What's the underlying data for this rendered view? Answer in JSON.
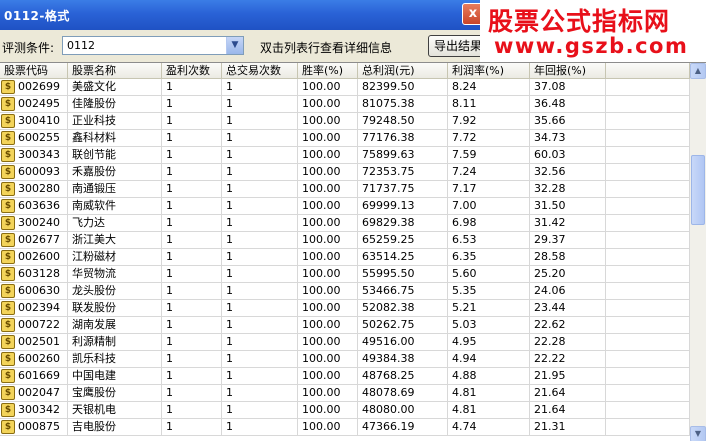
{
  "window": {
    "title": "0112-格式",
    "close_glyph": "x"
  },
  "watermark": {
    "line1": "股票公式指标网",
    "line2": "www.gszb.com"
  },
  "toolbar": {
    "condition_label": "评测条件:",
    "condition_value": "0112",
    "hint": "双击列表行查看详细信息",
    "export_label": "导出结果"
  },
  "columns": [
    "股票代码",
    "股票名称",
    "盈利次数",
    "总交易次数",
    "胜率(%)",
    "总利润(元)",
    "利润率(%)",
    "年回报(%)",
    ""
  ],
  "rows": [
    [
      "002699",
      "美盛文化",
      "1",
      "1",
      "100.00",
      "82399.50",
      "8.24",
      "37.08"
    ],
    [
      "002495",
      "佳隆股份",
      "1",
      "1",
      "100.00",
      "81075.38",
      "8.11",
      "36.48"
    ],
    [
      "300410",
      "正业科技",
      "1",
      "1",
      "100.00",
      "79248.50",
      "7.92",
      "35.66"
    ],
    [
      "600255",
      "鑫科材料",
      "1",
      "1",
      "100.00",
      "77176.38",
      "7.72",
      "34.73"
    ],
    [
      "300343",
      "联创节能",
      "1",
      "1",
      "100.00",
      "75899.63",
      "7.59",
      "60.03"
    ],
    [
      "600093",
      "禾嘉股份",
      "1",
      "1",
      "100.00",
      "72353.75",
      "7.24",
      "32.56"
    ],
    [
      "300280",
      "南通锻压",
      "1",
      "1",
      "100.00",
      "71737.75",
      "7.17",
      "32.28"
    ],
    [
      "603636",
      "南威软件",
      "1",
      "1",
      "100.00",
      "69999.13",
      "7.00",
      "31.50"
    ],
    [
      "300240",
      "飞力达",
      "1",
      "1",
      "100.00",
      "69829.38",
      "6.98",
      "31.42"
    ],
    [
      "002677",
      "浙江美大",
      "1",
      "1",
      "100.00",
      "65259.25",
      "6.53",
      "29.37"
    ],
    [
      "002600",
      "江粉磁材",
      "1",
      "1",
      "100.00",
      "63514.25",
      "6.35",
      "28.58"
    ],
    [
      "603128",
      "华贸物流",
      "1",
      "1",
      "100.00",
      "55995.50",
      "5.60",
      "25.20"
    ],
    [
      "600630",
      "龙头股份",
      "1",
      "1",
      "100.00",
      "53466.75",
      "5.35",
      "24.06"
    ],
    [
      "002394",
      "联发股份",
      "1",
      "1",
      "100.00",
      "52082.38",
      "5.21",
      "23.44"
    ],
    [
      "000722",
      "湖南发展",
      "1",
      "1",
      "100.00",
      "50262.75",
      "5.03",
      "22.62"
    ],
    [
      "002501",
      "利源精制",
      "1",
      "1",
      "100.00",
      "49516.00",
      "4.95",
      "22.28"
    ],
    [
      "600260",
      "凯乐科技",
      "1",
      "1",
      "100.00",
      "49384.38",
      "4.94",
      "22.22"
    ],
    [
      "601669",
      "中国电建",
      "1",
      "1",
      "100.00",
      "48768.25",
      "4.88",
      "21.95"
    ],
    [
      "002047",
      "宝鹰股份",
      "1",
      "1",
      "100.00",
      "48078.69",
      "4.81",
      "21.64"
    ],
    [
      "300342",
      "天银机电",
      "1",
      "1",
      "100.00",
      "48080.00",
      "4.81",
      "21.64"
    ],
    [
      "000875",
      "吉电股份",
      "1",
      "1",
      "100.00",
      "47366.19",
      "4.74",
      "21.31"
    ]
  ],
  "icons": {
    "row_icon": "dollar-coin-icon",
    "coin_glyph": "$"
  },
  "scrollbar": {
    "up_glyph": "▲",
    "down_glyph": "▼"
  }
}
